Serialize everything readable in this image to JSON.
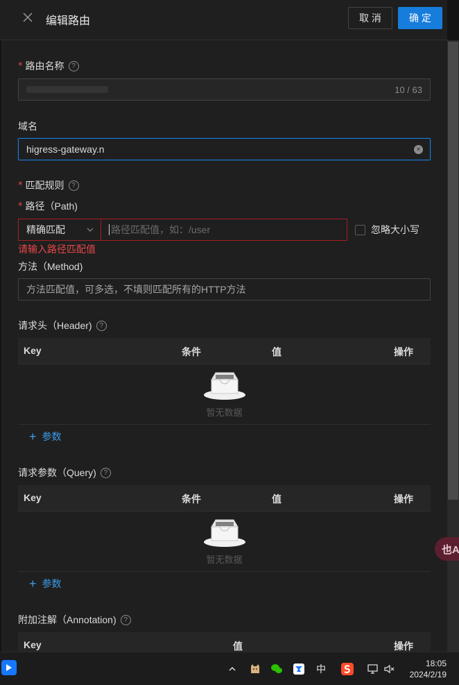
{
  "header": {
    "title": "编辑路由",
    "cancel_label": "取 消",
    "ok_label": "确 定"
  },
  "form": {
    "route_name": {
      "label": "路由名称",
      "count": "10 / 63"
    },
    "domain": {
      "label": "域名",
      "value": "higress-gateway.n"
    },
    "match_rules": {
      "label": "匹配规则"
    },
    "path": {
      "label": "路径（Path)",
      "match_type": "精确匹配",
      "placeholder": "路径匹配值，如：/user",
      "ignore_case_label": "忽略大小写",
      "error": "请输入路径匹配值"
    },
    "method": {
      "label": "方法（Method)",
      "placeholder": "方法匹配值，可多选，不填则匹配所有的HTTP方法"
    },
    "headers": {
      "label": "请求头（Header)",
      "columns": [
        "Key",
        "条件",
        "值",
        "操作"
      ],
      "empty_text": "暂无数据",
      "add_label": "参数"
    },
    "query": {
      "label": "请求参数（Query)",
      "columns": [
        "Key",
        "条件",
        "值",
        "操作"
      ],
      "empty_text": "暂无数据",
      "add_label": "参数"
    },
    "annotation": {
      "label": "附加注解（Annotation)",
      "columns": [
        "Key",
        "值",
        "操作"
      ]
    }
  },
  "floating": {
    "translate_label": "也A"
  },
  "taskbar": {
    "ime_label": "中",
    "time": "18:05",
    "date": "2024/2/19"
  },
  "colors": {
    "accent": "#177ddc",
    "error": "#e84749",
    "background": "#1f1f1f"
  }
}
